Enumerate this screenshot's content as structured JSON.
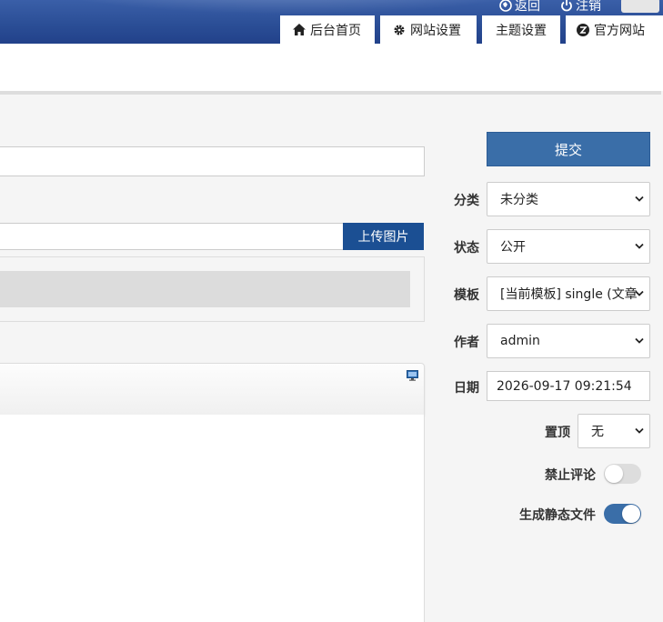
{
  "header": {
    "top_links": {
      "back": "返回",
      "logout": "注销"
    },
    "nav": {
      "admin_home": "后台首页",
      "site_settings": "网站设置",
      "theme_settings": "主题设置",
      "official_site": "官方网站"
    }
  },
  "editor": {
    "upload_label": "上传图片"
  },
  "sidebar": {
    "submit_label": "提交",
    "category": {
      "label": "分类",
      "value": "未分类"
    },
    "status": {
      "label": "状态",
      "value": "公开"
    },
    "template": {
      "label": "模板",
      "value": "[当前模板] single (文章"
    },
    "author": {
      "label": "作者",
      "value": "admin"
    },
    "date": {
      "label": "日期",
      "value": "2026-09-17 09:21:54"
    },
    "top": {
      "label": "置顶",
      "value": "无"
    },
    "disable_comments": {
      "label": "禁止评论",
      "on": false
    },
    "static_file": {
      "label": "生成静态文件",
      "on": true
    }
  },
  "colors": {
    "header_blue": "#2a4d95",
    "accent": "#3a6ea8",
    "upload_button": "#1b4f93"
  }
}
